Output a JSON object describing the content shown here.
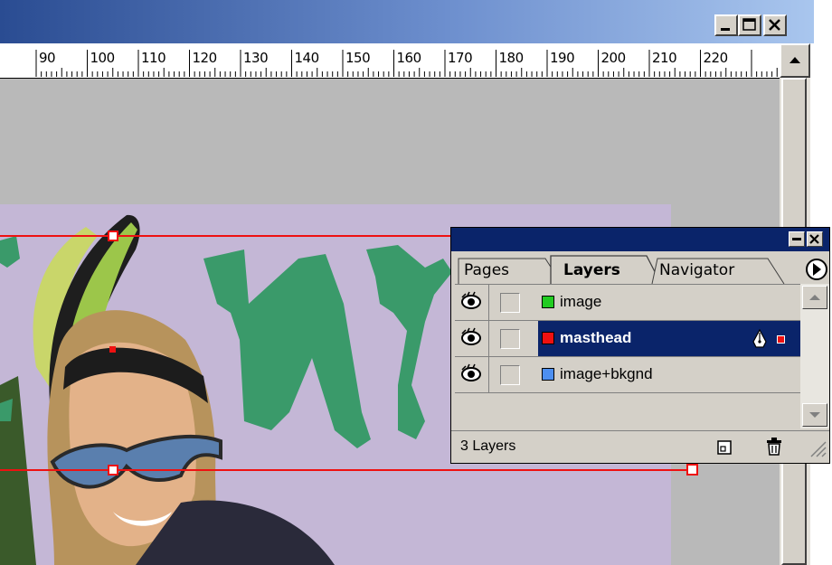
{
  "window": {
    "minimize_icon": "minimize-icon",
    "maximize_icon": "maximize-icon",
    "close_icon": "close-icon"
  },
  "ruler": {
    "labels": [
      "90",
      "100",
      "110",
      "120",
      "130",
      "140",
      "150",
      "160",
      "170",
      "180",
      "190",
      "200",
      "210",
      "220"
    ]
  },
  "palette": {
    "tabs": [
      "Pages",
      "Layers",
      "Navigator"
    ],
    "active_tab": "Layers",
    "layers": [
      {
        "name": "image",
        "color": "#22cc22",
        "selected": false
      },
      {
        "name": "masthead",
        "color": "#ee1111",
        "selected": true
      },
      {
        "name": "image+bkgnd",
        "color": "#4d8ff0",
        "selected": false
      }
    ],
    "status": "3 Layers",
    "icons": [
      "eye-icon",
      "pen-icon",
      "new-layer-icon",
      "trash-icon",
      "palette-menu-icon"
    ]
  },
  "colors": {
    "title_gradient_start": "#2a4c92",
    "title_gradient_end": "#a9c6ee",
    "page_background": "#c4b7d6",
    "pasteboard": "#b9b9b9",
    "selection": "#0a246a",
    "guide_red": "#ee1111"
  }
}
